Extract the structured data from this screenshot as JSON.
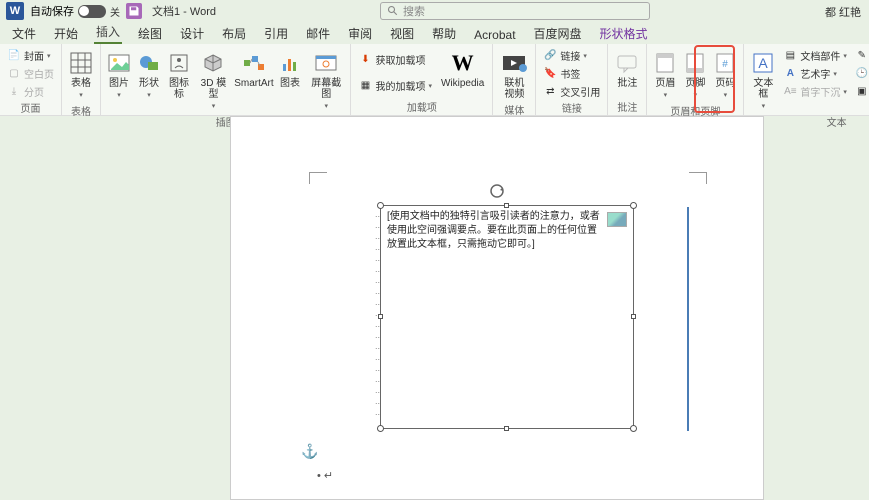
{
  "titlebar": {
    "autosave_label": "自动保存",
    "autosave_state": "关",
    "doc_title": "文档1 - Word",
    "search_placeholder": "搜索",
    "username": "都 红艳"
  },
  "tabs": [
    "文件",
    "开始",
    "插入",
    "绘图",
    "设计",
    "布局",
    "引用",
    "邮件",
    "审阅",
    "视图",
    "帮助",
    "Acrobat",
    "百度网盘",
    "形状格式"
  ],
  "active_tab": "插入",
  "ribbon": {
    "page": {
      "cover": "封面",
      "blank": "空白页",
      "break": "分页",
      "label": "页面"
    },
    "tables": {
      "table": "表格",
      "label": "表格"
    },
    "illustr": {
      "pic": "图片",
      "shapes": "形状",
      "icons": "图标",
      "model3d": "3D 模型",
      "smartart": "SmartArt",
      "chart": "图表",
      "screenshot": "屏幕截图",
      "label": "插图"
    },
    "addins": {
      "get": "获取加载项",
      "my": "我的加载项",
      "wikipedia": "Wikipedia",
      "label": "加载项"
    },
    "media": {
      "video": "联机视频",
      "label": "媒体"
    },
    "links": {
      "link": "链接",
      "bookmark": "书签",
      "crossref": "交叉引用",
      "label": "链接"
    },
    "comments": {
      "comment": "批注",
      "label": "批注"
    },
    "headerfooter": {
      "header": "页眉",
      "footer": "页脚",
      "pagenum": "页码",
      "label": "页眉和页脚"
    },
    "text": {
      "textbox": "文本框",
      "quickparts": "文档部件",
      "wordart": "艺术字",
      "dropcap": "首字下沉",
      "signature": "签名行",
      "datetime": "日期和时间",
      "object": "对象",
      "label": "文本"
    }
  },
  "document": {
    "textbox_content": "[使用文档中的独特引言吸引读者的注意力，或者使用此空间强调要点。要在此页面上的任何位置放置此文本框，只需拖动它即可。]",
    "partial_top": "",
    "partial_bottom": "",
    "para_mark": "• ↵"
  }
}
